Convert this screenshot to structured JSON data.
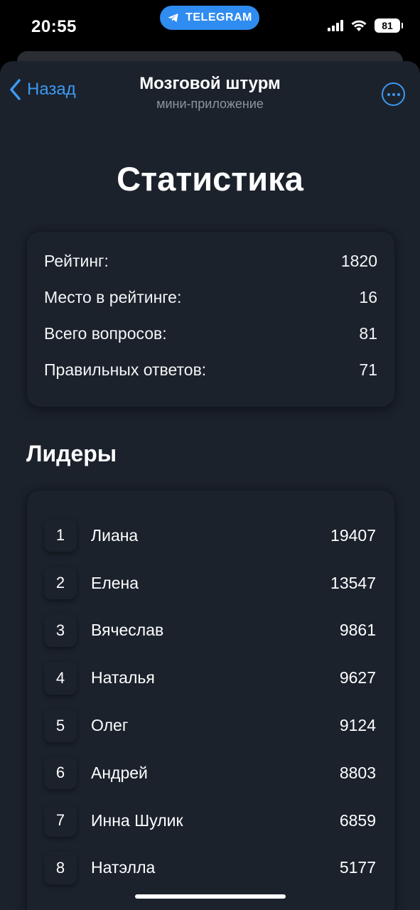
{
  "status_bar": {
    "time": "20:55",
    "pill_label": "TELEGRAM",
    "battery": "81"
  },
  "nav": {
    "back_label": "Назад",
    "title": "Мозговой штурм",
    "subtitle": "мини-приложение"
  },
  "page_title": "Статистика",
  "stats": [
    {
      "label": "Рейтинг:",
      "value": "1820"
    },
    {
      "label": "Место в рейтинге:",
      "value": "16"
    },
    {
      "label": "Всего вопросов:",
      "value": "81"
    },
    {
      "label": "Правильных ответов:",
      "value": "71"
    }
  ],
  "leaders_title": "Лидеры",
  "leaders": [
    {
      "rank": "1",
      "name": "Лиана",
      "score": "19407"
    },
    {
      "rank": "2",
      "name": "Елена",
      "score": "13547"
    },
    {
      "rank": "3",
      "name": "Вячеслав",
      "score": "9861"
    },
    {
      "rank": "4",
      "name": "Наталья",
      "score": "9627"
    },
    {
      "rank": "5",
      "name": "Олег",
      "score": "9124"
    },
    {
      "rank": "6",
      "name": "Андрей",
      "score": "8803"
    },
    {
      "rank": "7",
      "name": "Инна Шулик",
      "score": "6859"
    },
    {
      "rank": "8",
      "name": "Натэлла",
      "score": "5177"
    }
  ],
  "colors": {
    "accent": "#3d99f0",
    "background": "#1b222c",
    "telegram": "#2f8cf0"
  }
}
